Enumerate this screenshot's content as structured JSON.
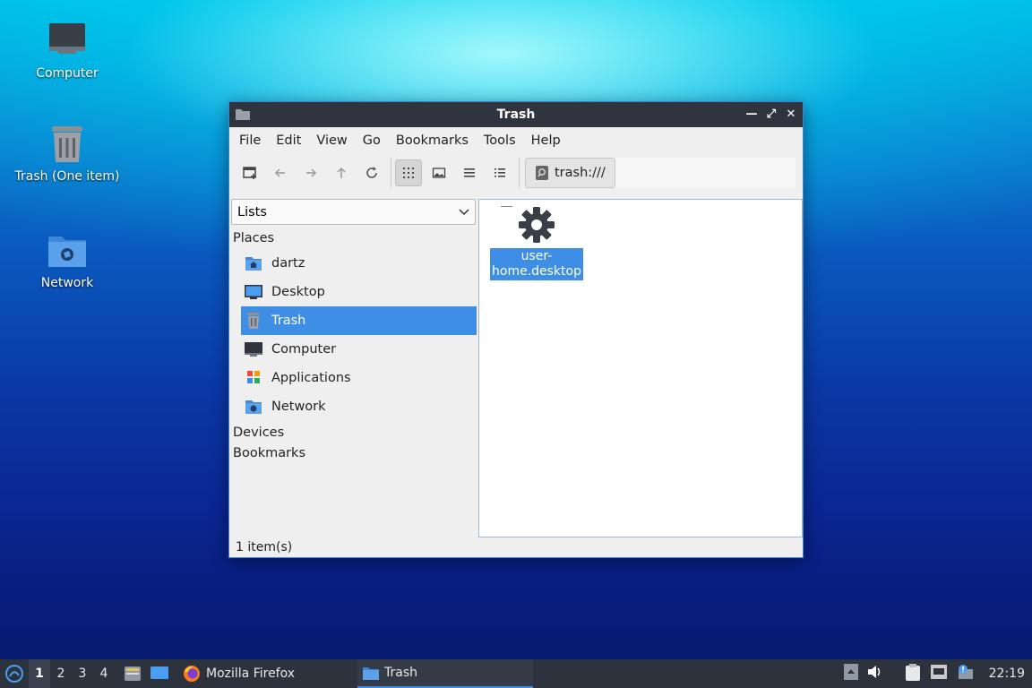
{
  "desktop": {
    "icons": [
      {
        "label": "Computer",
        "icon": "computer-icon"
      },
      {
        "label": "Trash (One item)",
        "icon": "trash-icon"
      },
      {
        "label": "Network",
        "icon": "network-folder-icon"
      }
    ]
  },
  "window": {
    "title": "Trash",
    "controls": [
      "minimize",
      "maximize",
      "close"
    ],
    "menu": [
      "File",
      "Edit",
      "View",
      "Go",
      "Bookmarks",
      "Tools",
      "Help"
    ],
    "toolbar": {
      "buttons": [
        "new-tab",
        "back",
        "forward",
        "up",
        "reload",
        "icon-view",
        "thumbnail-view",
        "compact-view",
        "detailed-list-view"
      ],
      "active_view": "icon-view",
      "path": "trash:///"
    },
    "sidebar": {
      "mode": "Lists",
      "places_heading": "Places",
      "places": [
        {
          "label": "dartz",
          "icon": "home-folder-icon"
        },
        {
          "label": "Desktop",
          "icon": "desktop-icon"
        },
        {
          "label": "Trash",
          "icon": "trash-icon",
          "selected": true
        },
        {
          "label": "Computer",
          "icon": "computer-icon"
        },
        {
          "label": "Applications",
          "icon": "applications-icon"
        },
        {
          "label": "Network",
          "icon": "network-icon"
        }
      ],
      "devices_heading": "Devices",
      "bookmarks_heading": "Bookmarks"
    },
    "files": [
      {
        "name": "user-home.desktop",
        "name_line1": "user-",
        "name_line2": "home.desktop",
        "icon": "gear-icon",
        "selected": true
      }
    ],
    "status": "1 item(s)"
  },
  "taskbar": {
    "workspaces": [
      "1",
      "2",
      "3",
      "4"
    ],
    "active_workspace": "1",
    "tasks": [
      {
        "label": "Mozilla Firefox",
        "icon": "firefox-icon"
      },
      {
        "label": "Trash",
        "icon": "folder-icon",
        "active": true
      }
    ],
    "clock": "22:19"
  },
  "colors": {
    "accent": "#3d8ee4",
    "titlebar": "#2f343f",
    "taskbar": "#2d333d"
  }
}
